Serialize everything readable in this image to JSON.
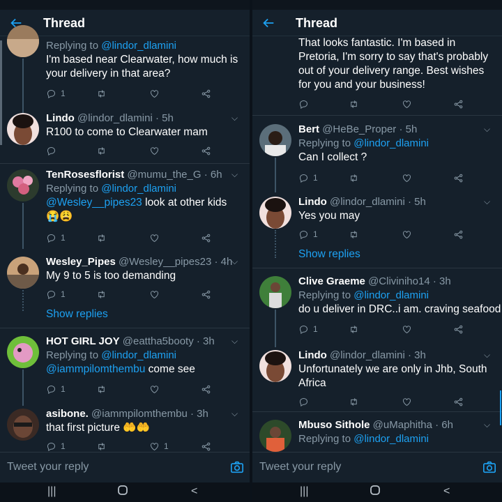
{
  "colors": {
    "background": "#15202b",
    "accent": "#1da1f2",
    "secondary_text": "#8899a6",
    "divider": "#2a3641"
  },
  "left": {
    "header_title": "Thread",
    "reply_placeholder": "Tweet your reply",
    "tweets": [
      {
        "replying_label": "Replying to",
        "replying_to": "@lindor_dlamini",
        "text": "I'm based near Clearwater, how much is your delivery in that area?",
        "reply_count": "1"
      },
      {
        "name": "Lindo",
        "handle": "@lindor_dlamini · 5h",
        "text": "R100 to come to Clearwater mam"
      },
      {
        "name": "TenRosesflorist",
        "handle": "@mumu_the_G · 6h",
        "replying_label": "Replying to",
        "replying_to": "@lindor_dlamini",
        "mention": "@Wesley__pipes23",
        "text": " look at other kids 😭😩",
        "reply_count": "1"
      },
      {
        "name": "Wesley_Pipes",
        "handle": "@Wesley__pipes23 · 4h",
        "text": "My 9 to 5 is too demanding",
        "reply_count": "1",
        "show_replies": "Show replies"
      },
      {
        "name": "HOT GIRL JOY",
        "handle": "@eattha5booty · 3h",
        "replying_label": "Replying to",
        "replying_to": "@lindor_dlamini",
        "mention": "@iammpilomthembu",
        "text": " come see",
        "reply_count": "1"
      },
      {
        "name": "asibone.",
        "handle": "@iammpilomthembu · 3h",
        "text": "that first picture 🤲🤲",
        "reply_count": "1",
        "like_count": "1"
      }
    ]
  },
  "right": {
    "header_title": "Thread",
    "reply_placeholder": "Tweet your reply",
    "tweets": [
      {
        "text": "That looks fantastic. I'm based in Pretoria, I'm sorry to say that's probably out of your delivery range. Best wishes for you and your business!"
      },
      {
        "name": "Bert",
        "handle": "@HeBe_Proper · 5h",
        "replying_label": "Replying to",
        "replying_to": "@lindor_dlamini",
        "text": "Can I collect ?",
        "reply_count": "1"
      },
      {
        "name": "Lindo",
        "handle": "@lindor_dlamini · 5h",
        "text": "Yes you may",
        "reply_count": "1",
        "show_replies": "Show replies"
      },
      {
        "name": "Clive Graeme",
        "handle": "@Cliviniho14 · 3h",
        "replying_label": "Replying to",
        "replying_to": "@lindor_dlamini",
        "text": "do u deliver in DRC..i am. craving seafood",
        "reply_count": "1"
      },
      {
        "name": "Lindo",
        "handle": "@lindor_dlamini · 3h",
        "text": "Unfortunately we are only in Jhb, South Africa"
      },
      {
        "name": "Mbuso Sithole",
        "handle": "@uMaphitha · 6h",
        "replying_label": "Replying to",
        "replying_to": "@lindor_dlamini"
      }
    ]
  },
  "icons": [
    "back-arrow-icon",
    "chevron-down-icon",
    "reply-icon",
    "retweet-icon",
    "like-icon",
    "share-icon",
    "camera-icon",
    "recents-icon",
    "home-icon",
    "back-nav-icon"
  ]
}
